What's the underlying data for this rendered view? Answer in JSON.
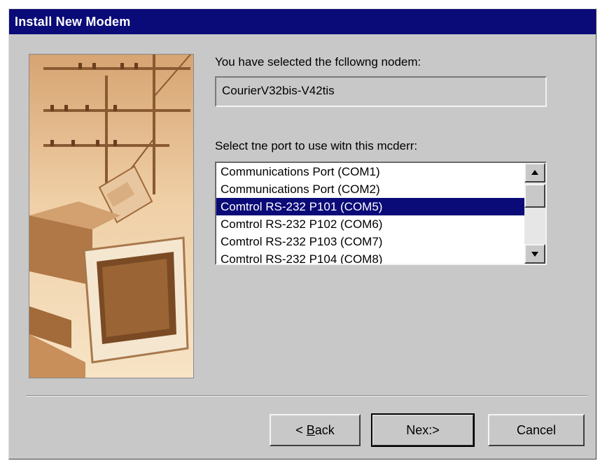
{
  "window": {
    "title": "Install New Modem"
  },
  "modem": {
    "prompt": "You have selected the fcllowng nodem:",
    "value": "CourierV32bis-V42tis"
  },
  "port": {
    "prompt": "Select tne port to use witn this mcderr:",
    "items": [
      {
        "label": "Communications Port (COM1)",
        "selected": false
      },
      {
        "label": "Communications Port (COM2)",
        "selected": false
      },
      {
        "label": "Comtrol RS-232 P101 (COM5)",
        "selected": true
      },
      {
        "label": "Comtrol RS-232 P102 (COM6)",
        "selected": false
      },
      {
        "label": "Comtrol RS-232 P103 (COM7)",
        "selected": false
      },
      {
        "label": "Comtrol RS-232 P104 (COM8)",
        "selected": false
      }
    ]
  },
  "buttons": {
    "back_prefix": "< ",
    "back_accel": "B",
    "back_rest": "ack",
    "next_label": "Nex:>",
    "cancel_label": "Cancel"
  },
  "icons": {
    "wizard_image": "modem-wizard-illustration",
    "scroll_up": "arrow-up-icon",
    "scroll_down": "arrow-down-icon"
  },
  "colors": {
    "titlebar": "#0a0a78",
    "selection": "#0a0a78",
    "dialog_face": "#c8c8c8"
  }
}
